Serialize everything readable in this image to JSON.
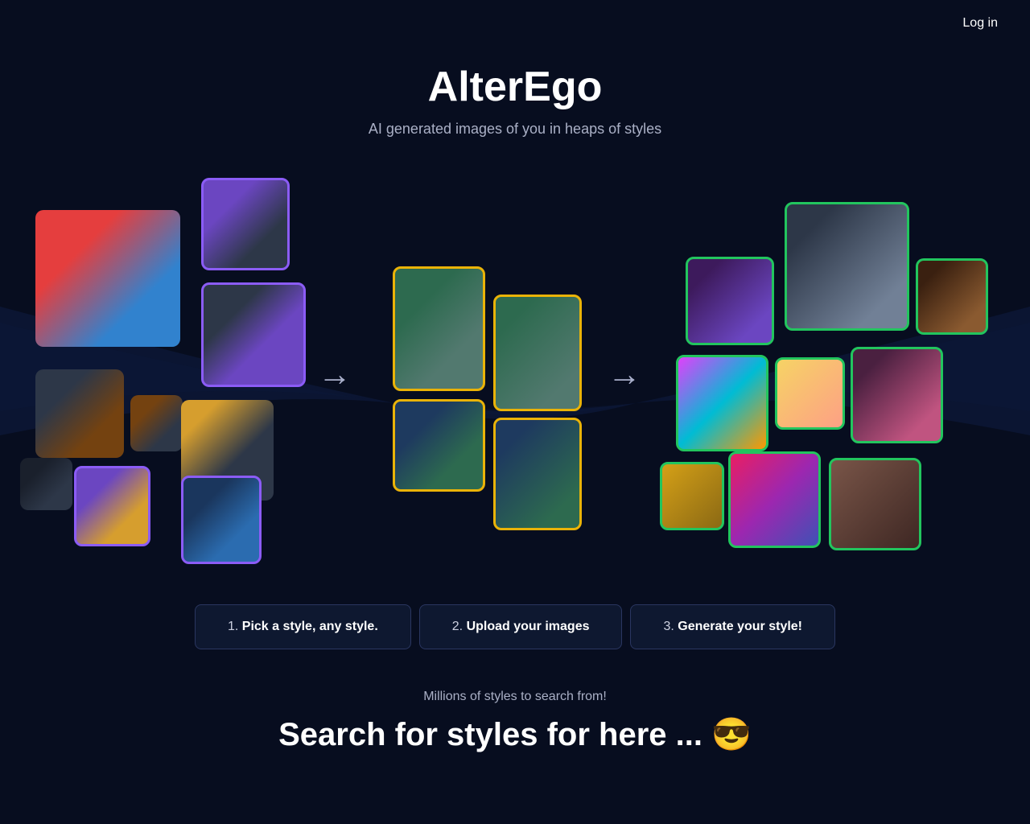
{
  "header": {
    "login_label": "Log in"
  },
  "hero": {
    "title": "AlterEgo",
    "subtitle": "AI generated images of you in heaps of styles"
  },
  "steps": [
    {
      "num": "1.",
      "label": "Pick a style, any style."
    },
    {
      "num": "2.",
      "label": "Upload your images"
    },
    {
      "num": "3.",
      "label": "Generate your style!"
    }
  ],
  "bottom": {
    "millions_text": "Millions of styles to search from!",
    "search_heading": "Search for styles for here ... 😎"
  }
}
